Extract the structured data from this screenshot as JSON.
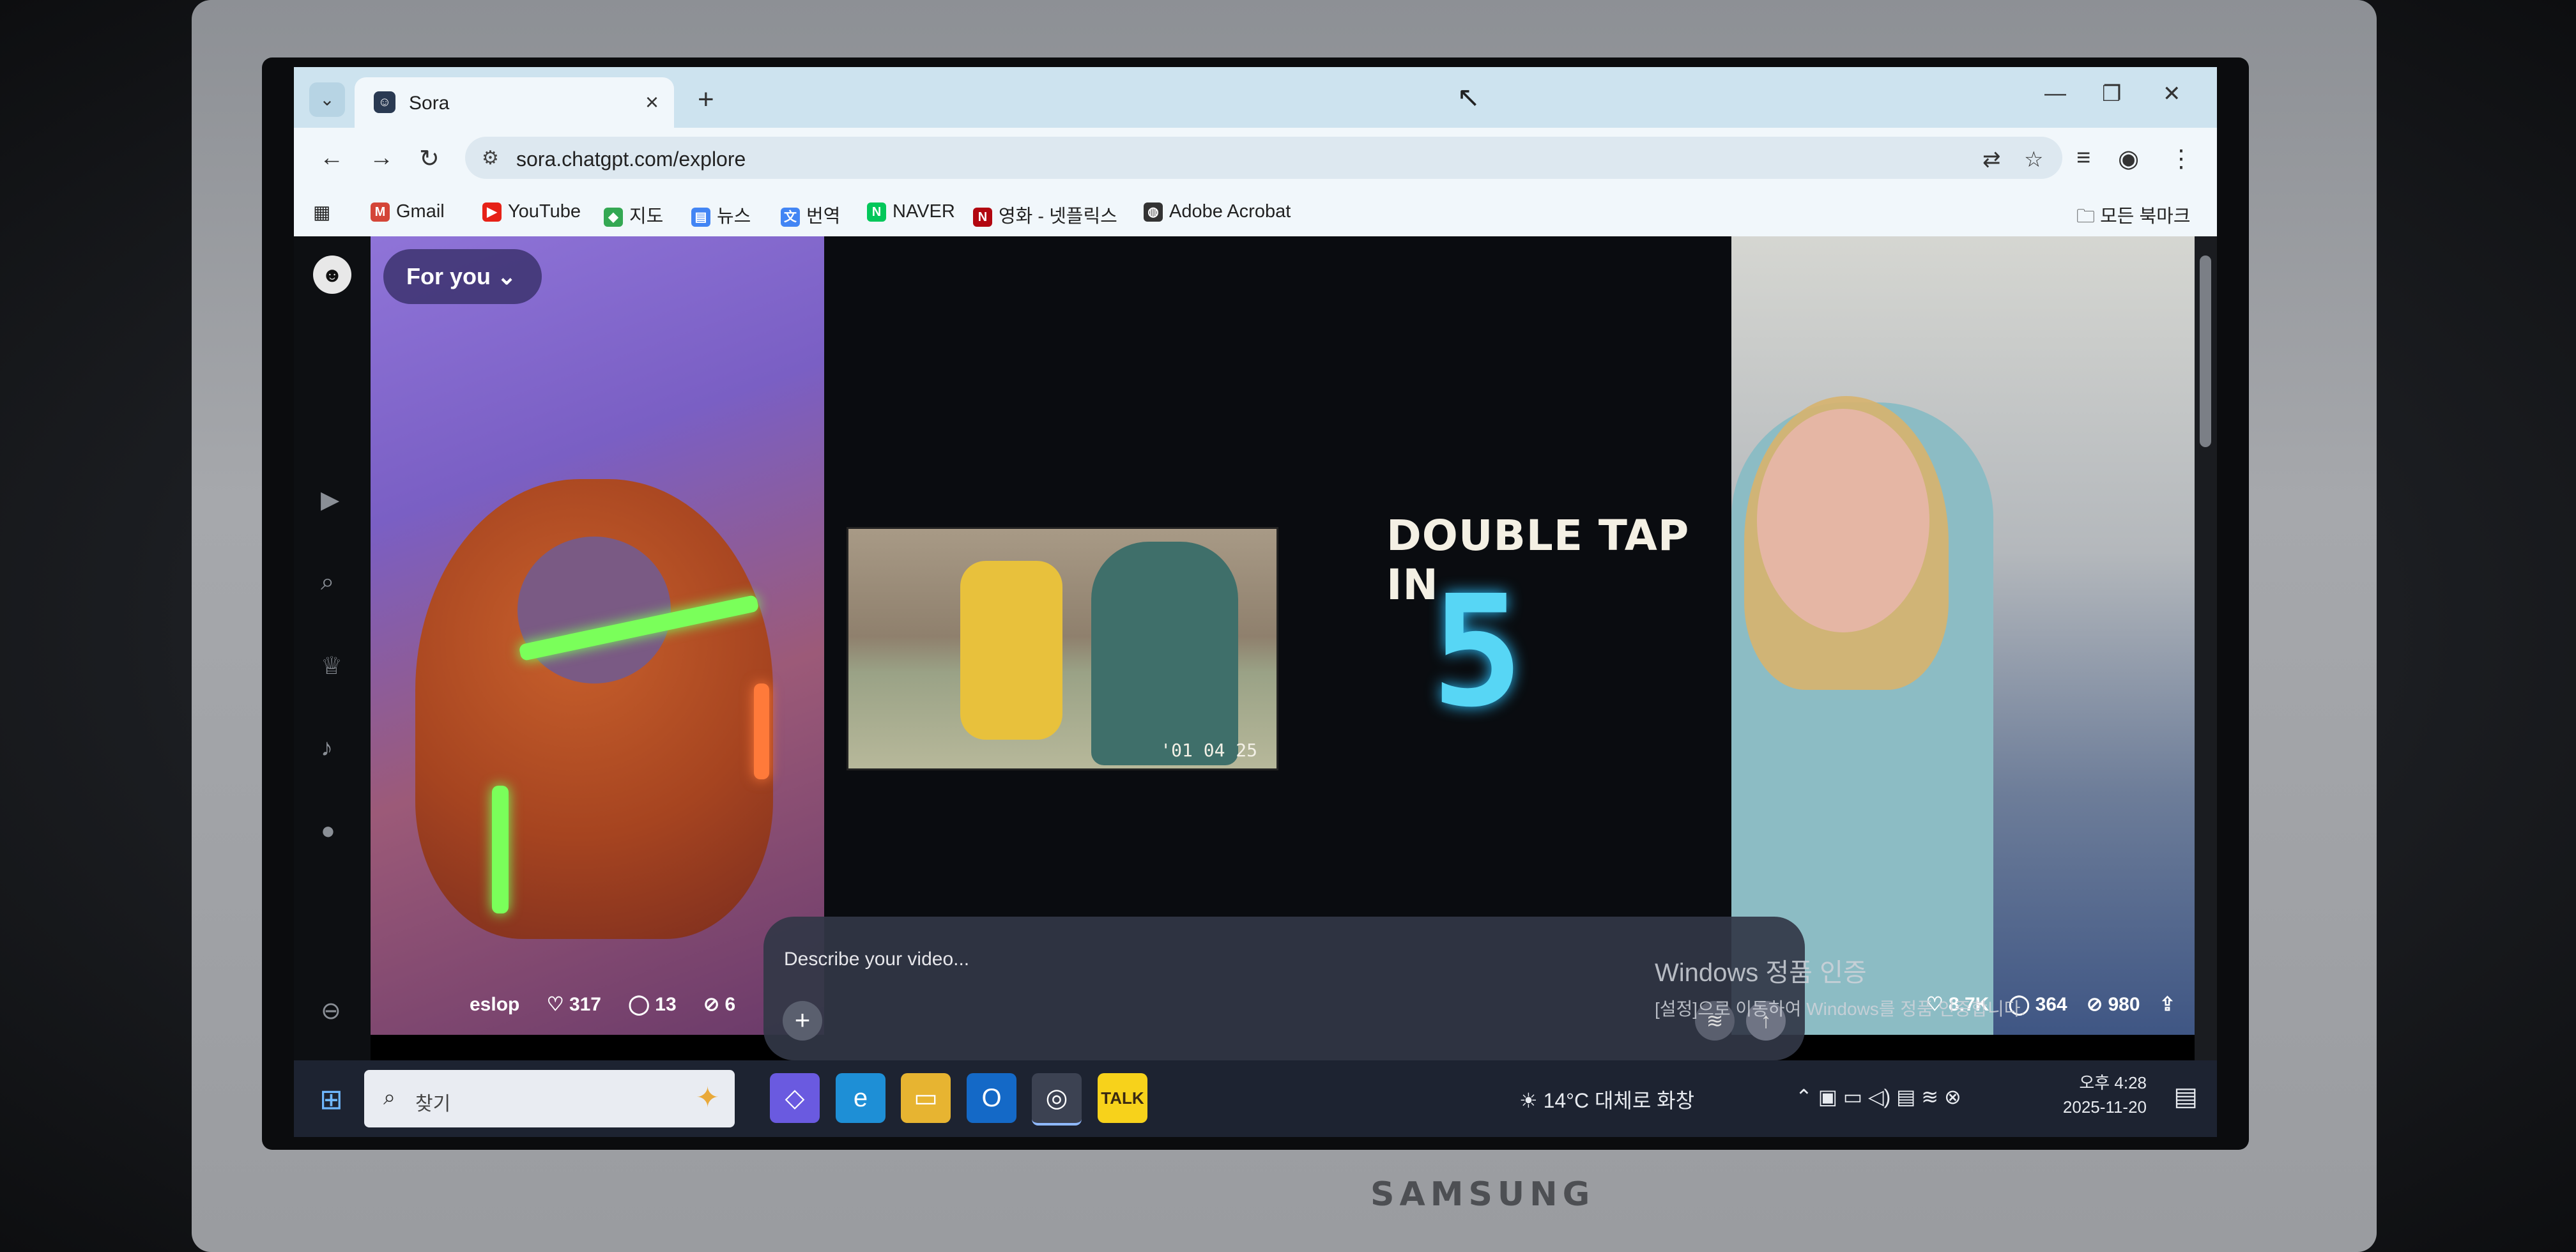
{
  "browser": {
    "tab_title": "Sora",
    "url": "sora.chatgpt.com/explore",
    "bookmarks": [
      "Gmail",
      "YouTube",
      "지도",
      "뉴스",
      "번역",
      "NAVER",
      "영화 - 넷플릭스",
      "Adobe Acrobat"
    ],
    "all_bookmarks": "모든 북마크"
  },
  "feed": {
    "filter_label": "For you",
    "video1": {
      "author": "eslop",
      "likes": "317",
      "comments": "13",
      "remixes": "6"
    },
    "video2": {
      "photo_date": "'01 04 25",
      "overlay_title": "DOUBLE TAP IN",
      "overlay_number": "5"
    },
    "video3": {
      "likes": "8.7K",
      "comments": "364",
      "remixes": "980"
    }
  },
  "prompt": {
    "placeholder": "Describe your video..."
  },
  "watermark": {
    "line1": "Windows 정품 인증",
    "line2": "[설정]으로 이동하여 Windows를 정품 인증합니다."
  },
  "taskbar": {
    "search_placeholder": "찾기",
    "weather": "14°C 대체로 화창",
    "time": "오후 4:28",
    "date": "2025-11-20"
  },
  "device": {
    "brand": "SAMSUNG"
  }
}
